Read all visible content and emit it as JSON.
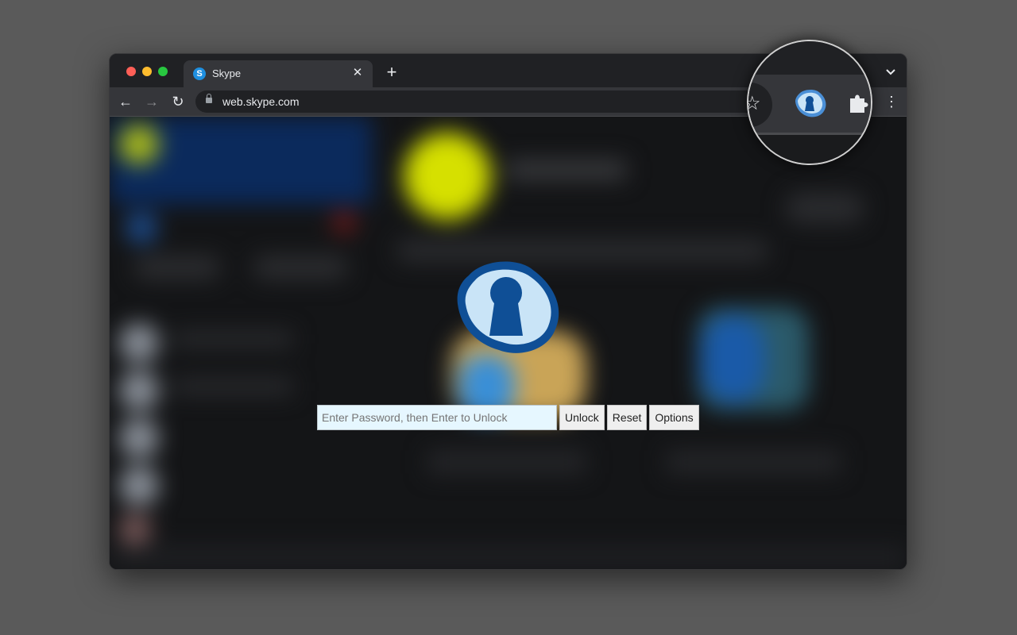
{
  "browser": {
    "tab": {
      "title": "Skype",
      "favicon_letter": "S",
      "favicon_icon": "skype-icon"
    },
    "new_tab_label": "+",
    "close_tab_label": "✕",
    "tab_menu_label": "⌄",
    "nav": {
      "back": "←",
      "forward": "→",
      "reload": "↻"
    },
    "url": "web.skype.com",
    "menu_label": "⋮"
  },
  "lock": {
    "password_placeholder": "Enter Password, then Enter to Unlock",
    "unlock_label": "Unlock",
    "reset_label": "Reset",
    "options_label": "Options"
  },
  "magnifier": {
    "star_label": "☆",
    "extension_icon": "keyhole-lock-icon",
    "puzzle_icon": "extensions-puzzle-icon",
    "menu_label": "⋮"
  },
  "colors": {
    "lock_logo_dark": "#0f4f96",
    "lock_logo_light": "#c9e4f7",
    "input_bg": "#e6f7ff"
  }
}
